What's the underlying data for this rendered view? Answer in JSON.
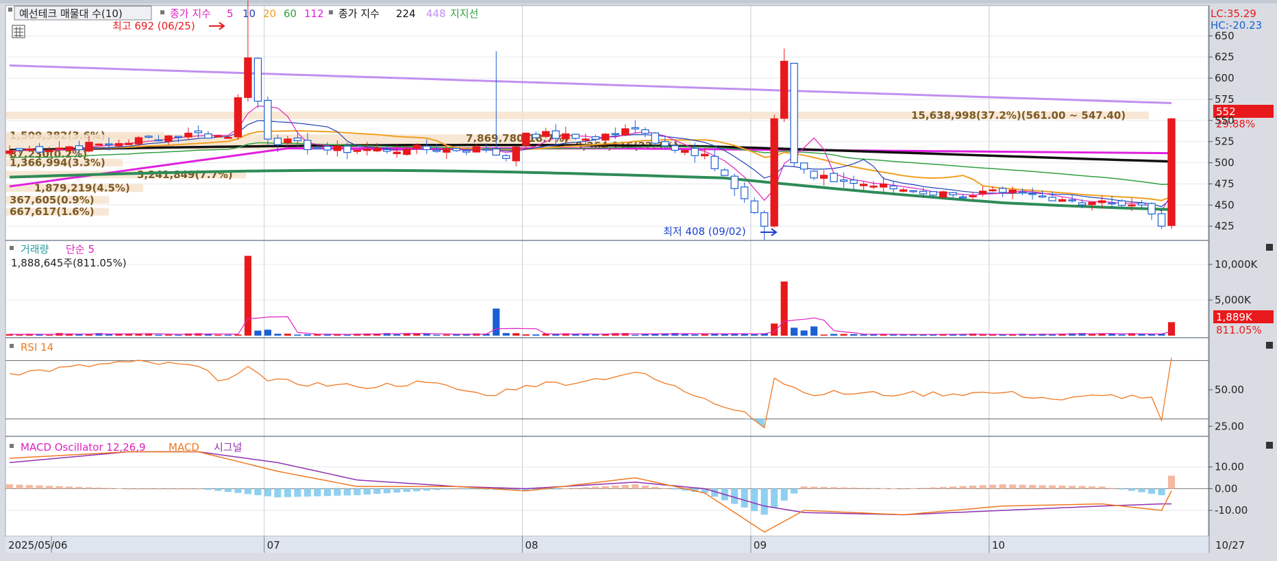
{
  "colors": {
    "up": "#e8191c",
    "down": "#1a5fd3",
    "ma5": "#e020c0",
    "ma10": "#1f3fb5",
    "ma20": "#f0a020",
    "ma60": "#30a040",
    "ma112": "#e020e0",
    "ma224": "#111111",
    "ma448": "#c090f0",
    "support": "#2e8b57",
    "rsi": "#f07820",
    "macd": "#f07820",
    "signal": "#9030b0",
    "osc_pos": "#f4b8a0",
    "osc_neg": "#8fd0f0"
  },
  "price_panel": {
    "title_box": "예선테크 매물대 수(10)",
    "legend_prefix": "종가 지수",
    "legend_ma": [
      "5",
      "10",
      "20",
      "60",
      "112"
    ],
    "legend_long_prefix": "종가 지수",
    "legend_long": [
      "224",
      "448"
    ],
    "legend_support": "지지선",
    "high_label": "최고 692 (06/25)",
    "low_label": "최저 408 (09/02)",
    "lc_label": "LC:35.29",
    "hc_label": "HC:-20.23",
    "last_price": "552",
    "last_change": "29.88%",
    "volume_profile_labels": [
      "15,638,998(37.2%)(561.00 ~ 547.40)",
      "1,509,382(3.6%)",
      "7,869,780(18.7%)",
      "9,364,116(22.3%)",
      "87,230(0.2%)",
      "1,366,994(3.3%)",
      "3,241,849(7.7%)",
      "1,879,219(4.5%)",
      "367,605(0.9%)",
      "667,617(1.6%)"
    ],
    "y_ticks": [
      "650",
      "625",
      "600",
      "575",
      "550",
      "525",
      "500",
      "475",
      "450",
      "425"
    ]
  },
  "volume_panel": {
    "title": "거래량",
    "ma_label": "단순 5",
    "info": "1,888,645주(811.05%)",
    "y_ticks": [
      "10,000K",
      "5,000K"
    ],
    "last_value": "1,889K",
    "last_pct": "811.05%"
  },
  "rsi_panel": {
    "title": "RSI 14",
    "y_ticks": [
      "50.00",
      "25.00"
    ]
  },
  "macd_panel": {
    "title": "MACD Oscillator 12,26,9",
    "macd_label": "MACD",
    "signal_label": "시그널",
    "y_ticks": [
      "10.00",
      "0.00",
      "-10.00"
    ]
  },
  "x_axis": {
    "labels": [
      "2025/05/06",
      "07",
      "08",
      "09",
      "10"
    ],
    "last_label": "10/27"
  },
  "chart_data": {
    "type": "candlestick",
    "n_days": 118,
    "dates_note": "2025/05/06 ~ 10/27 daily",
    "month_starts": [
      {
        "label": "07",
        "index": 26
      },
      {
        "label": "08",
        "index": 52
      },
      {
        "label": "09",
        "index": 75
      },
      {
        "label": "10",
        "index": 99
      }
    ],
    "ohlc_anchor_points": [
      {
        "day": 0,
        "close": 514
      },
      {
        "day": 10,
        "close": 522
      },
      {
        "day": 18,
        "close": 535
      },
      {
        "day": 22,
        "close": 530
      },
      {
        "day": 24,
        "close": 624
      },
      {
        "day": 26,
        "close": 528
      },
      {
        "day": 32,
        "close": 515
      },
      {
        "day": 40,
        "close": 516
      },
      {
        "day": 48,
        "close": 516
      },
      {
        "day": 50,
        "close": 505
      },
      {
        "day": 52,
        "close": 535
      },
      {
        "day": 58,
        "close": 528
      },
      {
        "day": 63,
        "close": 540
      },
      {
        "day": 66,
        "close": 520
      },
      {
        "day": 70,
        "close": 510
      },
      {
        "day": 72,
        "close": 485
      },
      {
        "day": 75,
        "close": 441
      },
      {
        "day": 76,
        "close": 425
      },
      {
        "day": 77,
        "close": 552
      },
      {
        "day": 78,
        "close": 620
      },
      {
        "day": 79,
        "close": 500
      },
      {
        "day": 81,
        "close": 482
      },
      {
        "day": 84,
        "close": 478
      },
      {
        "day": 90,
        "close": 468
      },
      {
        "day": 95,
        "close": 462
      },
      {
        "day": 100,
        "close": 465
      },
      {
        "day": 105,
        "close": 455
      },
      {
        "day": 110,
        "close": 455
      },
      {
        "day": 114,
        "close": 450
      },
      {
        "day": 116,
        "close": 425
      },
      {
        "day": 117,
        "close": 552
      }
    ],
    "high": {
      "value": 692,
      "date": "06/25"
    },
    "low": {
      "value": 408,
      "date": "09/02"
    },
    "last_close": 552,
    "change_pct": 29.88,
    "ylim": [
      413,
      660
    ],
    "volume_spikes_k": [
      {
        "day": 24,
        "value": 11200
      },
      {
        "day": 49,
        "value": 3800
      },
      {
        "day": 78,
        "value": 7600
      },
      {
        "day": 77,
        "value": 1700
      },
      {
        "day": 117,
        "value": 1889
      }
    ],
    "volume_ylim_k": [
      0,
      12500
    ],
    "rsi_anchor_points": [
      {
        "day": 0,
        "value": 61
      },
      {
        "day": 12,
        "value": 69
      },
      {
        "day": 19,
        "value": 66
      },
      {
        "day": 21,
        "value": 56
      },
      {
        "day": 24,
        "value": 66
      },
      {
        "day": 26,
        "value": 56
      },
      {
        "day": 35,
        "value": 52
      },
      {
        "day": 42,
        "value": 55
      },
      {
        "day": 48,
        "value": 46
      },
      {
        "day": 52,
        "value": 53
      },
      {
        "day": 58,
        "value": 56
      },
      {
        "day": 63,
        "value": 62
      },
      {
        "day": 70,
        "value": 44
      },
      {
        "day": 74,
        "value": 35
      },
      {
        "day": 76,
        "value": 24
      },
      {
        "day": 77,
        "value": 58
      },
      {
        "day": 80,
        "value": 48
      },
      {
        "day": 90,
        "value": 47
      },
      {
        "day": 100,
        "value": 48
      },
      {
        "day": 106,
        "value": 43
      },
      {
        "day": 110,
        "value": 46
      },
      {
        "day": 115,
        "value": 45
      },
      {
        "day": 116,
        "value": 29
      },
      {
        "day": 117,
        "value": 72
      }
    ],
    "rsi_ylim": [
      20,
      80
    ],
    "macd_anchor_points": [
      {
        "day": 0,
        "macd": 14,
        "signal": 12
      },
      {
        "day": 12,
        "macd": 17,
        "signal": 17
      },
      {
        "day": 19,
        "macd": 17,
        "signal": 17
      },
      {
        "day": 27,
        "macd": 8,
        "signal": 12
      },
      {
        "day": 35,
        "macd": 1,
        "signal": 4
      },
      {
        "day": 45,
        "macd": 1,
        "signal": 1
      },
      {
        "day": 52,
        "macd": -1,
        "signal": 0
      },
      {
        "day": 63,
        "macd": 5,
        "signal": 3
      },
      {
        "day": 70,
        "macd": -2,
        "signal": 0
      },
      {
        "day": 76,
        "macd": -20,
        "signal": -8
      },
      {
        "day": 80,
        "macd": -10,
        "signal": -11
      },
      {
        "day": 90,
        "macd": -12,
        "signal": -12
      },
      {
        "day": 100,
        "macd": -8,
        "signal": -10
      },
      {
        "day": 110,
        "macd": -7,
        "signal": -8
      },
      {
        "day": 116,
        "macd": -10,
        "signal": -7
      },
      {
        "day": 117,
        "macd": -1,
        "signal": -7
      }
    ],
    "macd_ylim": [
      -21,
      20
    ]
  }
}
